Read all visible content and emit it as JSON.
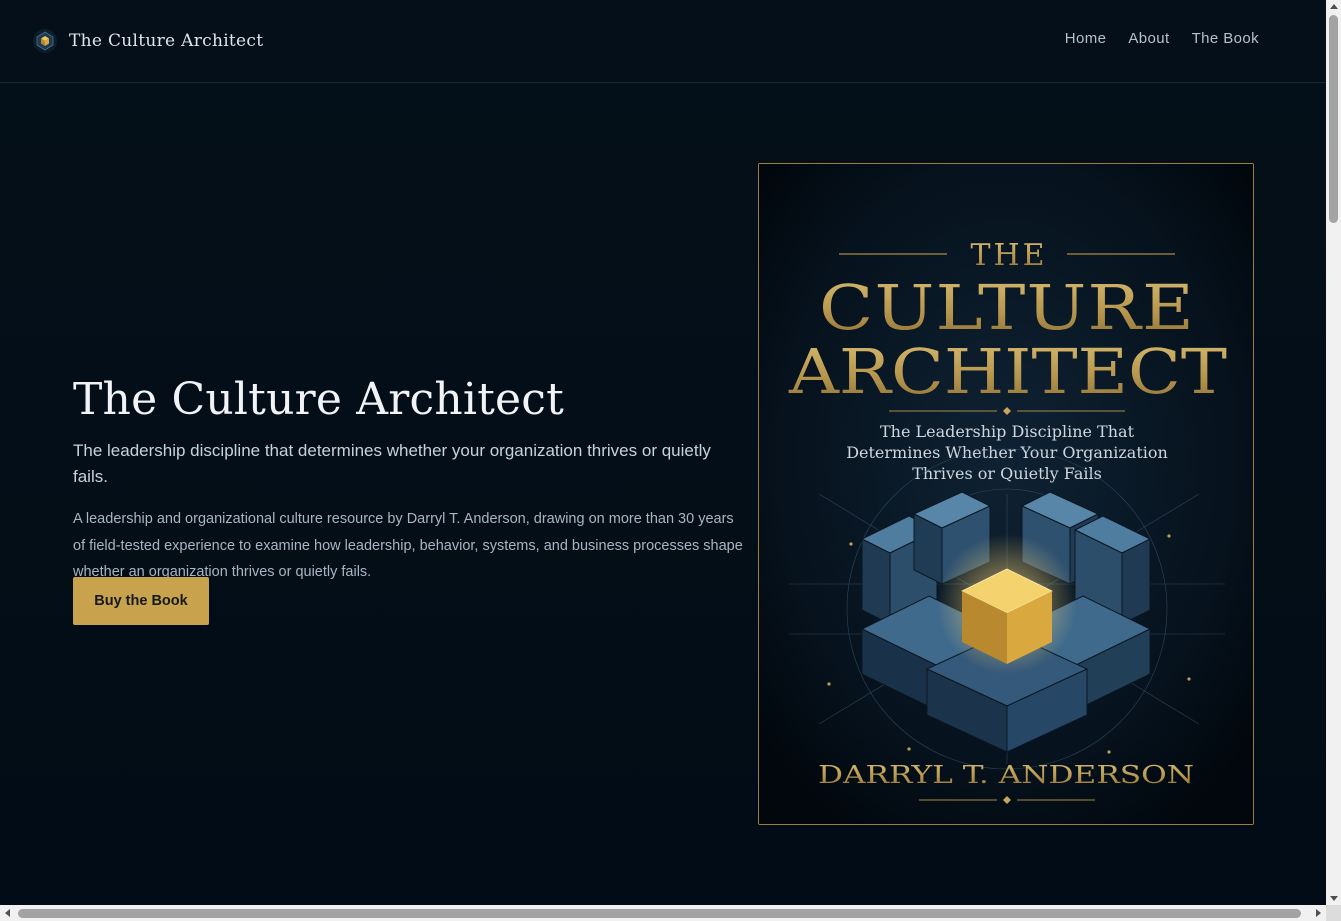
{
  "colors": {
    "background": "#040f1a",
    "accent_gold": "#c8a24d",
    "text_primary": "#f1f3f6",
    "text_muted": "#a9b5c2"
  },
  "header": {
    "logo_icon": "geometric-cube-logo-icon",
    "site_title": "The Culture Architect",
    "nav": [
      {
        "label": "Home"
      },
      {
        "label": "About"
      },
      {
        "label": "The Book"
      }
    ]
  },
  "hero": {
    "title": "The Culture Architect",
    "tagline": "The leadership discipline that determines whether your organization thrives or quietly fails.",
    "description": "A leadership and organizational culture resource by Darryl T. Anderson, drawing on more than 30 years of field-tested experience to examine how leadership, behavior, systems, and business processes shape whether an organization thrives or quietly fails.",
    "cta_label": "Buy the Book"
  },
  "book_cover": {
    "title_line_1": "THE",
    "title_line_2": "CULTURE",
    "title_line_3": "ARCHITECT",
    "subtitle_line_1": "The Leadership Discipline That",
    "subtitle_line_2": "Determines Whether Your Organization",
    "subtitle_line_3": "Thrives or Quietly Fails",
    "author": "DARRYL T. ANDERSON",
    "artwork_icon": "glowing-isometric-cube-icon"
  }
}
